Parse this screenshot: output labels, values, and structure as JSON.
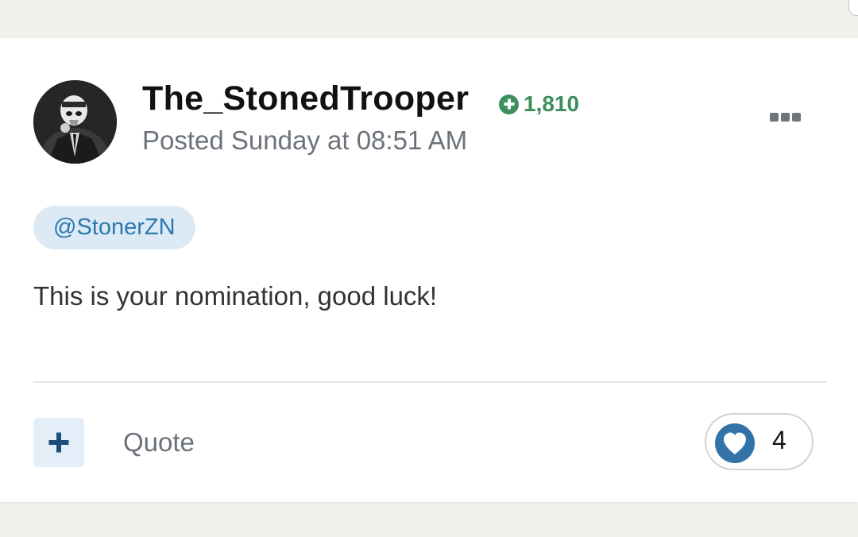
{
  "post": {
    "author": "The_StonedTrooper",
    "reputation": "1,810",
    "posted": "Posted Sunday at 08:51 AM",
    "mention": "@StonerZN",
    "body": "This is your nomination, good luck!",
    "quote_label": "Quote",
    "reaction_count": "4"
  },
  "icons": {
    "reputation": "plus-circle-icon",
    "more": "ellipsis-icon",
    "multiquote": "plus-icon",
    "reaction": "heart-icon"
  },
  "colors": {
    "reputation": "#3d8f5d",
    "mention_bg": "#dceaf5",
    "mention_text": "#2c79ae",
    "heart_bg": "#3373a8",
    "multiquote_plus": "#1d4e7a"
  }
}
